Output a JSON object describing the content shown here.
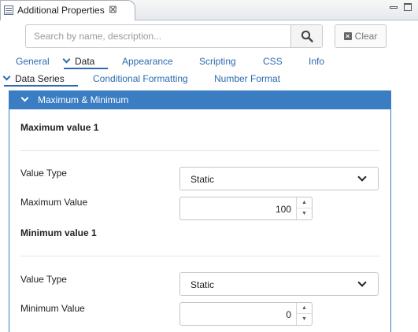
{
  "view": {
    "title": "Additional Properties",
    "close_glyph": "⊠"
  },
  "search": {
    "placeholder": "Search by name, description...",
    "value": "",
    "clear_label": "Clear"
  },
  "main_tabs": [
    {
      "label": "General",
      "active": false
    },
    {
      "label": "Data",
      "active": true
    },
    {
      "label": "Appearance",
      "active": false
    },
    {
      "label": "Scripting",
      "active": false
    },
    {
      "label": "CSS",
      "active": false
    },
    {
      "label": "Info",
      "active": false
    }
  ],
  "sub_tabs": [
    {
      "label": "Data Series",
      "active": true
    },
    {
      "label": "Conditional Formatting",
      "active": false
    },
    {
      "label": "Number Format",
      "active": false
    }
  ],
  "panel": {
    "title": "Maximum & Minimum",
    "maximum": {
      "section_title": "Maximum value 1",
      "value_type_label": "Value Type",
      "value_type": "Static",
      "value_label": "Maximum Value",
      "value": "100"
    },
    "minimum": {
      "section_title": "Minimum value 1",
      "value_type_label": "Value Type",
      "value_type": "Static",
      "value_label": "Minimum Value",
      "value": "0"
    }
  },
  "spinner_glyphs": {
    "up": "▲",
    "down": "▼"
  },
  "colors": {
    "accent": "#3a7dc2",
    "link": "#2d6bb0"
  }
}
